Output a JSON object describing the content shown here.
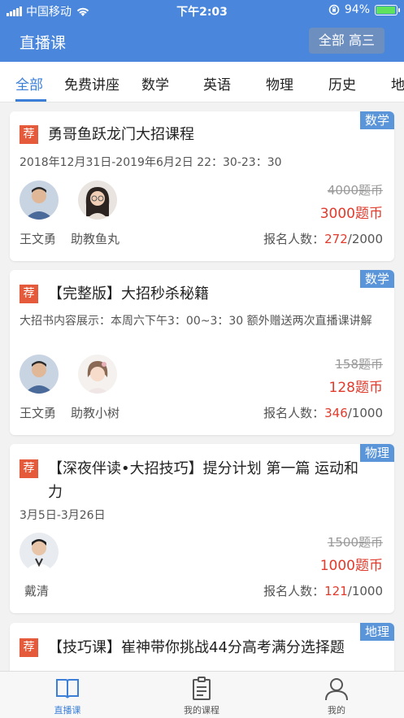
{
  "status_bar": {
    "carrier": "中国移动",
    "time": "下午2:03",
    "battery": "94%",
    "battery_level": 0.94
  },
  "header": {
    "title": "直播课",
    "filter_label": "全部 高三"
  },
  "tabs": [
    "全部",
    "免费讲座",
    "数学",
    "英语",
    "物理",
    "历史",
    "地"
  ],
  "courses": [
    {
      "subject": "数学",
      "badge": "荐",
      "title": "勇哥鱼跃龙门大招课程",
      "date": "2018年12月31日-2019年6月2日 22：30-23：30",
      "teachers": [
        {
          "name": "王文勇",
          "icon": "teacher-avatar"
        },
        {
          "name": "助教鱼丸",
          "icon": "assistant-avatar"
        }
      ],
      "original_price": "4000题币",
      "price": "3000题币",
      "enroll_label": "报名人数：",
      "enroll_count": "272",
      "enroll_total": "/2000"
    },
    {
      "subject": "数学",
      "badge": "荐",
      "title": "【完整版】大招秒杀秘籍",
      "date": "大招书内容展示：本周六下午3：00~3：30  额外赠送两次直播课讲解",
      "teachers": [
        {
          "name": "王文勇",
          "icon": "teacher-avatar"
        },
        {
          "name": "助教小树",
          "icon": "assistant-avatar"
        }
      ],
      "original_price": "158题币",
      "price": "128题币",
      "enroll_label": "报名人数：",
      "enroll_count": "346",
      "enroll_total": "/1000"
    },
    {
      "subject": "物理",
      "badge": "荐",
      "title": "【深夜伴读•大招技巧】提分计划  第一篇 运动和力",
      "date": "3月5日-3月26日",
      "teachers": [
        {
          "name": "戴清",
          "icon": "teacher-avatar"
        }
      ],
      "original_price": "1500题币",
      "price": "1000题币",
      "enroll_label": "报名人数：",
      "enroll_count": "121",
      "enroll_total": "/1000"
    },
    {
      "subject": "地理",
      "badge": "荐",
      "title": "【技巧课】崔神带你挑战44分高考满分选择题"
    }
  ],
  "bottom_nav": [
    {
      "label": "直播课",
      "icon": "book-icon",
      "active": true
    },
    {
      "label": "我的课程",
      "icon": "clipboard-icon",
      "active": false
    },
    {
      "label": "我的",
      "icon": "person-icon",
      "active": false
    }
  ],
  "colors": {
    "primary": "#4a87dc",
    "accent_red": "#e03b2c",
    "tag_blue": "#5b95d9",
    "badge_red": "#e45a3a"
  }
}
